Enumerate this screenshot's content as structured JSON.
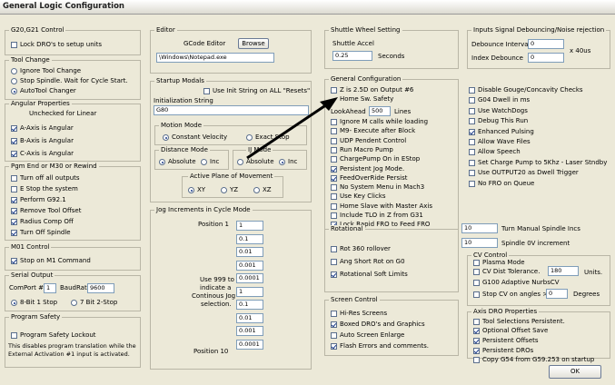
{
  "window": {
    "title": "General Logic Configuration"
  },
  "g20": {
    "title": "G20,G21 Control",
    "lock": "Lock DRO's to setup units"
  },
  "tool": {
    "title": "Tool Change",
    "opts": [
      "Ignore Tool Change",
      "Stop Spindle. Wait for Cycle Start.",
      "AutoTool Changer"
    ]
  },
  "ang": {
    "title": "Angular Properties",
    "note": "Unchecked for Linear",
    "a": "A-Axis is Angular",
    "b": "B-Axis is Angular",
    "c": "C-Axis is Angular"
  },
  "pgm": {
    "title": "Pgm End or M30 or Rewind",
    "items": [
      "Turn off all outputs",
      "E Stop the system",
      "Perform G92.1",
      "Remove Tool Offset",
      "Radius Comp Off",
      "Turn Off Spindle"
    ]
  },
  "m01": {
    "title": "M01 Control",
    "stop": "Stop on M1 Command"
  },
  "serial": {
    "title": "Serial Output",
    "comport_label": "ComPort #",
    "comport": "1",
    "baud_label": "BaudRate",
    "baud": "9600",
    "bits8": "8-Bit 1 Stop",
    "bits7": "7 Bit 2-Stop"
  },
  "safety": {
    "title": "Program Safety",
    "lockout": "Program Safety Lockout",
    "note1": "This disables program translation while the",
    "note2": "External Activation #1 input is activated."
  },
  "editor": {
    "title": "Editor",
    "label": "GCode Editor",
    "browse": "Browse",
    "path": "\\Windows\\Notepad.exe"
  },
  "startup": {
    "title": "Startup Modals",
    "use_init": "Use Init String on ALL  \"Resets\"",
    "init_label": "Initialization String",
    "init": "G80"
  },
  "motion": {
    "title": "Motion Mode",
    "cv": "Constant Velocity",
    "es": "Exact Stop"
  },
  "dist": {
    "title": "Distance Mode",
    "abs": "Absolute",
    "inc": "Inc"
  },
  "ij": {
    "title": "IJ Mode",
    "abs": "Absolute",
    "inc": "Inc"
  },
  "plane": {
    "title": "Active Plane of Movement",
    "xy": "XY",
    "yz": "YZ",
    "xz": "XZ"
  },
  "jog": {
    "title": "Jog Increments in Cycle Mode",
    "pos1": "Position 1",
    "pos10": "Position 10",
    "note": [
      "Use 999 to",
      "indicate a",
      "Continous Jog",
      "selection."
    ],
    "values": [
      "1",
      "0.1",
      "0.01",
      "0.001",
      "0.0001",
      "1",
      "0.1",
      "0.01",
      "0.001",
      "0.0001"
    ]
  },
  "shuttle": {
    "title": "Shuttle Wheel Setting",
    "accel_label": "Shuttle Accel",
    "accel": "0.25",
    "unit": "Seconds"
  },
  "debounce": {
    "title": "Inputs Signal Debouncing/Noise rejection",
    "interval_label": "Debounce Interval",
    "interval": "0",
    "index_label": "Index Debounce",
    "index": "0",
    "unit": "x 40us"
  },
  "genconf": {
    "title": "General Configuration",
    "z25": "Z is 2.5D on Output #6",
    "home_safety": "Home Sw. Safety",
    "lookahead_label": "LookAhead",
    "lookahead": "500",
    "lines": "Lines",
    "items": [
      "Ignore M calls while loading",
      "M9- Execute after Block",
      "UDP Pendent Control",
      "Run Macro Pump",
      "ChargePump On in EStop",
      "Persistent Jog Mode.",
      "FeedOverRide Persist",
      "No System Menu in Mach3",
      "Use Key Clicks",
      "Home Slave with Master Axis",
      "Include TLO in Z from G31",
      "Lock Rapid FRO to Feed FRO"
    ],
    "right": [
      "Disable Gouge/Concavity Checks",
      "G04 Dwell in ms",
      "Use WatchDogs",
      "Debug This Run",
      "Enhanced Pulsing",
      "Allow Wave Files",
      "Allow Speech",
      "Set Charge Pump to 5Khz  - Laser Stndby",
      "Use OUTPUT20 as Dwell Trigger",
      "No FRO on Queue"
    ],
    "manual_spindle": "10",
    "manual_spindle_label": "Turn Manual Spindle Incs",
    "spindle_ov": "10",
    "spindle_ov_label": "Spindle 0V increment"
  },
  "rot": {
    "title": "Rotational",
    "items": [
      "Rot 360 rollover",
      "Ang Short Rot on G0",
      "Rotational Soft Limits"
    ]
  },
  "screen": {
    "title": "Screen Control",
    "items": [
      "Hi-Res Screens",
      "Boxed DRO's and Graphics",
      "Auto Screen Enlarge",
      "Flash Errors and comments."
    ]
  },
  "cv": {
    "title": "CV Control",
    "plasma": "Plasma Mode",
    "tol_label": "CV Dist Tolerance.",
    "tol": "180",
    "units": "Units.",
    "g100": "G100 Adaptive NurbsCV",
    "stop_label": "Stop CV on angles >",
    "stop": "0",
    "deg": "Degrees"
  },
  "axis": {
    "title": "Axis DRO Properties",
    "items": [
      "Tool Selections Persistent.",
      "Optional Offset Save",
      "Persistent Offsets",
      "Persistent DROs",
      "Copy G54 from G59.253 on startup"
    ]
  },
  "ok": "OK"
}
